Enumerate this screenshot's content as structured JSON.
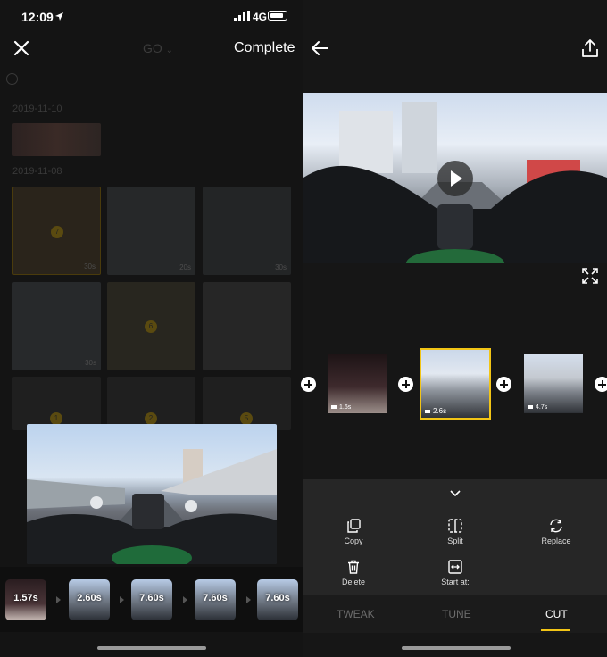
{
  "status_bar": {
    "time": "12:09",
    "network": "4G"
  },
  "left": {
    "header": {
      "dropdown_label": "GO",
      "complete_label": "Complete"
    },
    "dates": [
      "2019-11-10",
      "2019-11-08"
    ],
    "grid": [
      {
        "badge": "7",
        "duration": "30s",
        "selected": true
      },
      {
        "badge": "",
        "duration": "20s",
        "selected": false
      },
      {
        "badge": "",
        "duration": "30s",
        "selected": false
      },
      {
        "badge": "",
        "duration": "30s",
        "selected": false
      },
      {
        "badge": "6",
        "duration": "",
        "selected": false
      },
      {
        "badge": "",
        "duration": "",
        "selected": false
      }
    ],
    "grid_row3_badges": [
      "1",
      "2",
      "5"
    ],
    "strip": [
      "1.57s",
      "2.60s",
      "7.60s",
      "7.60s",
      "7.60s"
    ]
  },
  "right": {
    "clips": [
      {
        "duration": "1.6s",
        "selected": false
      },
      {
        "duration": "2.6s",
        "selected": true
      },
      {
        "duration": "4.7s",
        "selected": false
      }
    ],
    "tools": {
      "copy": "Copy",
      "split": "Split",
      "replace": "Replace",
      "delete": "Delete",
      "start_at": "Start at:"
    },
    "tabs": {
      "tweak": "TWEAK",
      "tune": "TUNE",
      "cut": "CUT"
    }
  },
  "colors": {
    "accent": "#f2c516",
    "background": "#141414",
    "tool_panel": "#262626"
  }
}
